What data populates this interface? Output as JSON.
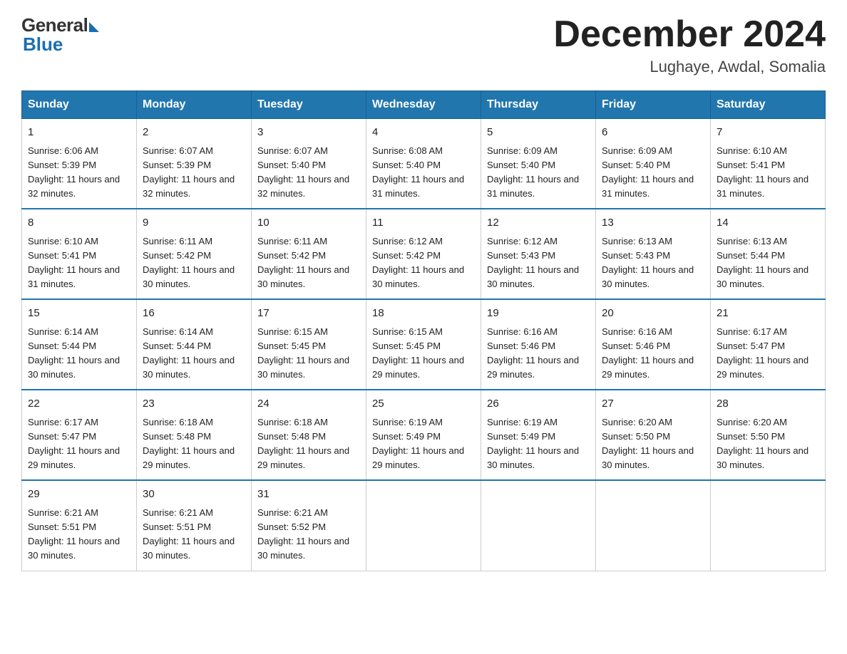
{
  "header": {
    "logo_general": "General",
    "logo_blue": "Blue",
    "month_title": "December 2024",
    "location": "Lughaye, Awdal, Somalia"
  },
  "days_of_week": [
    "Sunday",
    "Monday",
    "Tuesday",
    "Wednesday",
    "Thursday",
    "Friday",
    "Saturday"
  ],
  "weeks": [
    [
      {
        "day": "1",
        "sunrise": "6:06 AM",
        "sunset": "5:39 PM",
        "daylight": "11 hours and 32 minutes."
      },
      {
        "day": "2",
        "sunrise": "6:07 AM",
        "sunset": "5:39 PM",
        "daylight": "11 hours and 32 minutes."
      },
      {
        "day": "3",
        "sunrise": "6:07 AM",
        "sunset": "5:40 PM",
        "daylight": "11 hours and 32 minutes."
      },
      {
        "day": "4",
        "sunrise": "6:08 AM",
        "sunset": "5:40 PM",
        "daylight": "11 hours and 31 minutes."
      },
      {
        "day": "5",
        "sunrise": "6:09 AM",
        "sunset": "5:40 PM",
        "daylight": "11 hours and 31 minutes."
      },
      {
        "day": "6",
        "sunrise": "6:09 AM",
        "sunset": "5:40 PM",
        "daylight": "11 hours and 31 minutes."
      },
      {
        "day": "7",
        "sunrise": "6:10 AM",
        "sunset": "5:41 PM",
        "daylight": "11 hours and 31 minutes."
      }
    ],
    [
      {
        "day": "8",
        "sunrise": "6:10 AM",
        "sunset": "5:41 PM",
        "daylight": "11 hours and 31 minutes."
      },
      {
        "day": "9",
        "sunrise": "6:11 AM",
        "sunset": "5:42 PM",
        "daylight": "11 hours and 30 minutes."
      },
      {
        "day": "10",
        "sunrise": "6:11 AM",
        "sunset": "5:42 PM",
        "daylight": "11 hours and 30 minutes."
      },
      {
        "day": "11",
        "sunrise": "6:12 AM",
        "sunset": "5:42 PM",
        "daylight": "11 hours and 30 minutes."
      },
      {
        "day": "12",
        "sunrise": "6:12 AM",
        "sunset": "5:43 PM",
        "daylight": "11 hours and 30 minutes."
      },
      {
        "day": "13",
        "sunrise": "6:13 AM",
        "sunset": "5:43 PM",
        "daylight": "11 hours and 30 minutes."
      },
      {
        "day": "14",
        "sunrise": "6:13 AM",
        "sunset": "5:44 PM",
        "daylight": "11 hours and 30 minutes."
      }
    ],
    [
      {
        "day": "15",
        "sunrise": "6:14 AM",
        "sunset": "5:44 PM",
        "daylight": "11 hours and 30 minutes."
      },
      {
        "day": "16",
        "sunrise": "6:14 AM",
        "sunset": "5:44 PM",
        "daylight": "11 hours and 30 minutes."
      },
      {
        "day": "17",
        "sunrise": "6:15 AM",
        "sunset": "5:45 PM",
        "daylight": "11 hours and 30 minutes."
      },
      {
        "day": "18",
        "sunrise": "6:15 AM",
        "sunset": "5:45 PM",
        "daylight": "11 hours and 29 minutes."
      },
      {
        "day": "19",
        "sunrise": "6:16 AM",
        "sunset": "5:46 PM",
        "daylight": "11 hours and 29 minutes."
      },
      {
        "day": "20",
        "sunrise": "6:16 AM",
        "sunset": "5:46 PM",
        "daylight": "11 hours and 29 minutes."
      },
      {
        "day": "21",
        "sunrise": "6:17 AM",
        "sunset": "5:47 PM",
        "daylight": "11 hours and 29 minutes."
      }
    ],
    [
      {
        "day": "22",
        "sunrise": "6:17 AM",
        "sunset": "5:47 PM",
        "daylight": "11 hours and 29 minutes."
      },
      {
        "day": "23",
        "sunrise": "6:18 AM",
        "sunset": "5:48 PM",
        "daylight": "11 hours and 29 minutes."
      },
      {
        "day": "24",
        "sunrise": "6:18 AM",
        "sunset": "5:48 PM",
        "daylight": "11 hours and 29 minutes."
      },
      {
        "day": "25",
        "sunrise": "6:19 AM",
        "sunset": "5:49 PM",
        "daylight": "11 hours and 29 minutes."
      },
      {
        "day": "26",
        "sunrise": "6:19 AM",
        "sunset": "5:49 PM",
        "daylight": "11 hours and 30 minutes."
      },
      {
        "day": "27",
        "sunrise": "6:20 AM",
        "sunset": "5:50 PM",
        "daylight": "11 hours and 30 minutes."
      },
      {
        "day": "28",
        "sunrise": "6:20 AM",
        "sunset": "5:50 PM",
        "daylight": "11 hours and 30 minutes."
      }
    ],
    [
      {
        "day": "29",
        "sunrise": "6:21 AM",
        "sunset": "5:51 PM",
        "daylight": "11 hours and 30 minutes."
      },
      {
        "day": "30",
        "sunrise": "6:21 AM",
        "sunset": "5:51 PM",
        "daylight": "11 hours and 30 minutes."
      },
      {
        "day": "31",
        "sunrise": "6:21 AM",
        "sunset": "5:52 PM",
        "daylight": "11 hours and 30 minutes."
      },
      null,
      null,
      null,
      null
    ]
  ]
}
